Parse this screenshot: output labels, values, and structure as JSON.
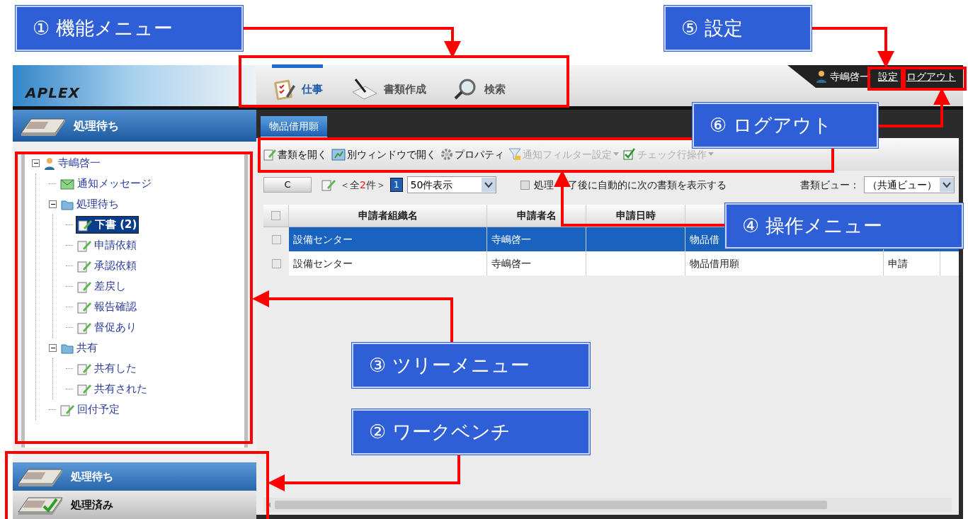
{
  "callouts": [
    {
      "text": "① 機能メニュー"
    },
    {
      "text": "⑤ 設定"
    },
    {
      "text": "⑥ ログアウト"
    },
    {
      "text": "④ 操作メニュー"
    },
    {
      "text": "③ ツリーメニュー"
    },
    {
      "text": "② ワークベンチ"
    }
  ],
  "header": {
    "logo": "APLEX",
    "nav": [
      {
        "label": "仕事",
        "selected": true,
        "kind": "work"
      },
      {
        "label": "書類作成",
        "selected": false,
        "kind": "create"
      },
      {
        "label": "検索",
        "selected": false,
        "kind": "search"
      }
    ],
    "user": "寺嶋啓一",
    "settings": "設定",
    "logout": "ログアウト"
  },
  "sidebar": {
    "title": "処理待ち",
    "tree": [
      {
        "label": "寺嶋啓一",
        "kind": "user",
        "expanded": true,
        "selected": false,
        "children": [
          {
            "label": "通知メッセージ",
            "kind": "mail",
            "selected": false
          },
          {
            "label": "処理待ち",
            "kind": "folder",
            "expanded": true,
            "selected": false,
            "children": [
              {
                "label": "下書 (2)",
                "kind": "doc",
                "selected": true
              },
              {
                "label": "申請依頼",
                "kind": "doc",
                "selected": false
              },
              {
                "label": "承認依頼",
                "kind": "doc",
                "selected": false
              },
              {
                "label": "差戻し",
                "kind": "doc",
                "selected": false
              },
              {
                "label": "報告確認",
                "kind": "doc",
                "selected": false
              },
              {
                "label": "督促あり",
                "kind": "doc",
                "selected": false
              }
            ]
          },
          {
            "label": "共有",
            "kind": "folder",
            "expanded": true,
            "selected": false,
            "children": [
              {
                "label": "共有した",
                "kind": "doc",
                "selected": false
              },
              {
                "label": "共有された",
                "kind": "doc",
                "selected": false
              }
            ]
          },
          {
            "label": "回付予定",
            "kind": "doc",
            "selected": false
          }
        ]
      }
    ],
    "bottom": [
      {
        "label": "処理待ち",
        "selected": true
      },
      {
        "label": "処理済み",
        "selected": false
      }
    ]
  },
  "workbench": {
    "tab": "物品借用願",
    "toolbar": [
      {
        "label": "書類を開く",
        "kind": "open",
        "disabled": false,
        "dropdown": false
      },
      {
        "label": "別ウィンドウで開く",
        "kind": "window",
        "disabled": false,
        "dropdown": false
      },
      {
        "label": "プロパティ",
        "kind": "gear",
        "disabled": false,
        "dropdown": false
      },
      {
        "label": "通知フィルター設定",
        "kind": "filter",
        "disabled": true,
        "dropdown": true
      },
      {
        "label": "チェック行操作",
        "kind": "check",
        "disabled": true,
        "dropdown": true
      }
    ],
    "pager": {
      "refresh": "C",
      "count_prefix": "＜全",
      "count": "2",
      "count_suffix": "件＞",
      "page": "1",
      "page_size": "50件表示",
      "auto_next": {
        "label_parts": [
          "処理",
          "了後に自動的に次の書類を表示する"
        ],
        "checked": false
      }
    },
    "view": {
      "label": "書類ビュー：",
      "value": "（共通ビュー）"
    },
    "table": {
      "select_all_checked": false,
      "columns": [
        "申請者組織名",
        "申請者名",
        "申請日時"
      ],
      "rows": [
        {
          "selected": true,
          "checked": false,
          "cells": [
            "設備センター",
            "寺嶋啓一",
            "",
            "物品借"
          ]
        },
        {
          "selected": false,
          "checked": false,
          "cells": [
            "設備センター",
            "寺嶋啓一",
            "",
            "物品借用願",
            "申請"
          ]
        }
      ]
    }
  }
}
